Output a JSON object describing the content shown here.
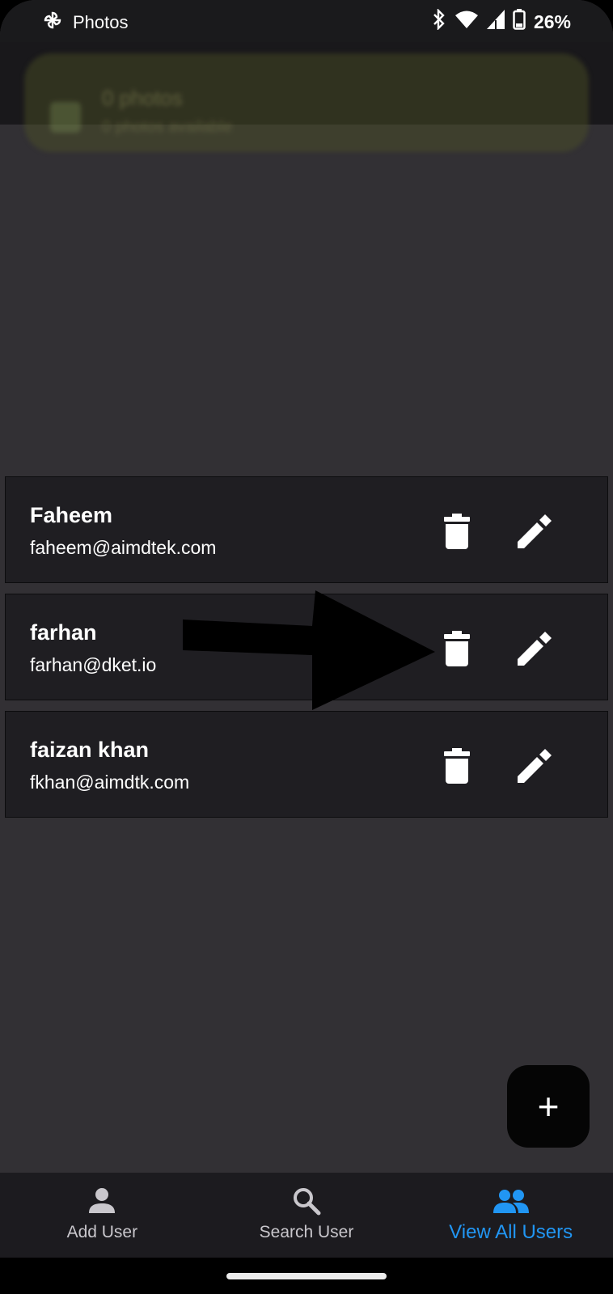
{
  "status_bar": {
    "app_name": "Photos",
    "battery": "26%"
  },
  "notification": {
    "title": "0 photos",
    "subtitle": "0 photos available"
  },
  "users": [
    {
      "name": "Faheem",
      "email": "faheem@aimdtek.com"
    },
    {
      "name": "farhan",
      "email": "farhan@dket.io"
    },
    {
      "name": "faizan khan",
      "email": "fkhan@aimdtk.com"
    }
  ],
  "fab": {
    "label": "+"
  },
  "bottom_nav": {
    "items": [
      {
        "label": "Add User",
        "icon": "person-icon"
      },
      {
        "label": "Search User",
        "icon": "search-icon"
      },
      {
        "label": "View All Users",
        "icon": "group-icon",
        "active": true
      }
    ]
  },
  "colors": {
    "accent": "#2196f3",
    "background": "#323034",
    "card": "#1f1e22"
  }
}
